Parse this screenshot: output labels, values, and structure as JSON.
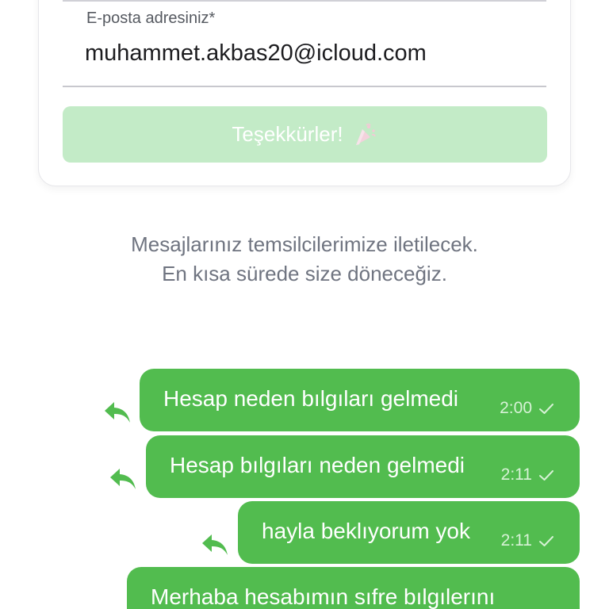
{
  "form": {
    "email_label": "E-posta adresiniz*",
    "email_value": "muhammet.akbas20@icloud.com",
    "submit_label": "Teşekkürler!",
    "submit_icon": "confetti-icon"
  },
  "info_text": "Mesajlarınız temsilcilerimize iletilecek. En kısa sürede size döneceğiz.",
  "messages": [
    {
      "text": "Hesap neden bılgıları gelmedi",
      "time": "2:00",
      "status": "sent"
    },
    {
      "text": "Hesap bılgıları neden gelmedi",
      "time": "2:11",
      "status": "sent"
    },
    {
      "text": "hayla beklıyorum yok",
      "time": "2:11",
      "status": "sent"
    },
    {
      "text": "Merhaba hesabımın sıfre bılgılerını",
      "time": "",
      "status": "sent"
    }
  ],
  "colors": {
    "bubble": "#52bc4f",
    "button_disabled": "#c3ebc7",
    "info_text": "#6f7480"
  }
}
